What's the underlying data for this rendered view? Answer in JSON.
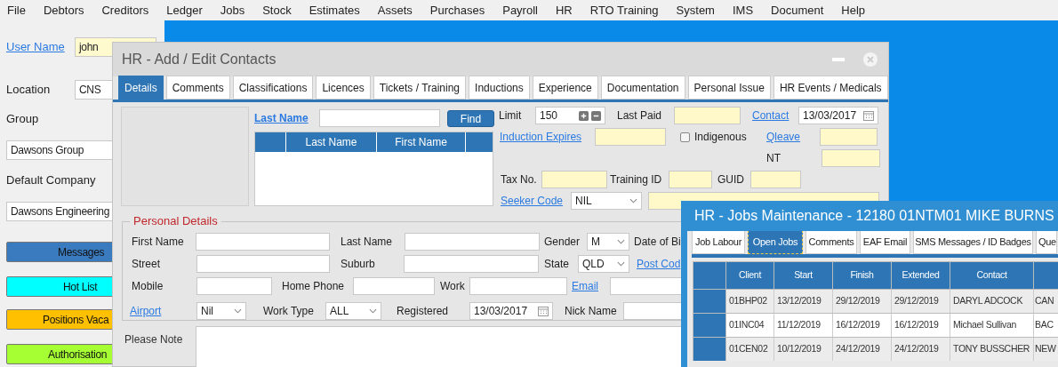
{
  "menu": [
    "File",
    "Debtors",
    "Creditors",
    "Ledger",
    "Jobs",
    "Stock",
    "Estimates",
    "Assets",
    "Purchases",
    "Payroll",
    "HR",
    "RTO Training",
    "System",
    "IMS",
    "Document",
    "Help"
  ],
  "sidebar": {
    "fields": [
      {
        "label": "User Name",
        "kind": "link",
        "value": "john",
        "highlighted": true
      },
      {
        "label": "Location",
        "kind": "label",
        "value": "CNS",
        "highlighted": false
      },
      {
        "label": "Group",
        "kind": "label",
        "value": "Dawsons Group",
        "highlighted": false
      },
      {
        "label": "Default Company",
        "kind": "label",
        "value": "Dawsons Engineering",
        "highlighted": false
      }
    ],
    "buttons": [
      {
        "label": "Messages",
        "color": "#3a7bbf"
      },
      {
        "label": "Hot List",
        "color": "#00ffff"
      },
      {
        "label": "Positions Vaca",
        "color": "#ffc000"
      },
      {
        "label": "Authorisation",
        "color": "#a6ff33"
      }
    ]
  },
  "contacts_window": {
    "title": "HR - Add / Edit Contacts",
    "tabs": [
      {
        "label": "Details",
        "selected": true
      },
      {
        "label": "Comments",
        "selected": false
      },
      {
        "label": "Classifications",
        "selected": false
      },
      {
        "label": "Licences",
        "selected": false
      },
      {
        "label": "Tickets / Training",
        "selected": false
      },
      {
        "label": "Inductions",
        "selected": false
      },
      {
        "label": "Experience",
        "selected": false
      },
      {
        "label": "Documentation",
        "selected": false
      },
      {
        "label": "Personal Issue",
        "selected": false
      },
      {
        "label": "HR Events / Medicals",
        "selected": false
      }
    ],
    "search": {
      "link": "Last Name",
      "button": "Find",
      "columns": [
        "Last Name",
        "First Name"
      ]
    },
    "fields": [
      [
        {
          "kind": "label",
          "text": "Limit"
        },
        {
          "kind": "spin",
          "value": "150"
        },
        {
          "kind": "label",
          "text": "Last Paid"
        },
        {
          "kind": "input",
          "highlighted": true
        },
        {
          "kind": "link",
          "text": "Contact"
        },
        {
          "kind": "date",
          "value": "13/03/2017"
        }
      ],
      [
        {
          "kind": "link",
          "text": "Induction Expires"
        },
        {
          "kind": "input",
          "highlighted": true
        },
        {
          "kind": "checkbox",
          "text": "Indigenous",
          "checked": false
        },
        {
          "kind": "link",
          "text": "Qleave"
        },
        {
          "kind": "input",
          "highlighted": true
        }
      ],
      [
        {
          "kind": "label",
          "text": "NT"
        },
        {
          "kind": "input",
          "highlighted": true
        }
      ],
      [
        {
          "kind": "label",
          "text": "Tax No."
        },
        {
          "kind": "input",
          "highlighted": true
        },
        {
          "kind": "label",
          "text": "Training ID"
        },
        {
          "kind": "input",
          "highlighted": true
        },
        {
          "kind": "label",
          "text": "GUID"
        },
        {
          "kind": "input",
          "highlighted": true
        }
      ],
      [
        {
          "kind": "link",
          "text": "Seeker Code"
        },
        {
          "kind": "select",
          "value": "NIL"
        },
        {
          "kind": "input",
          "highlighted": true
        }
      ]
    ],
    "personal_details": {
      "legend": "Personal Details",
      "rows": [
        [
          {
            "kind": "label",
            "text": "First Name"
          },
          {
            "kind": "input",
            "highlighted": false
          },
          {
            "kind": "label",
            "text": "Last Name"
          },
          {
            "kind": "input",
            "highlighted": false
          },
          {
            "kind": "label",
            "text": "Gender"
          },
          {
            "kind": "select",
            "value": "M"
          },
          {
            "kind": "label",
            "text": "Date of Bi"
          }
        ],
        [
          {
            "kind": "label",
            "text": "Street"
          },
          {
            "kind": "input",
            "highlighted": false
          },
          {
            "kind": "label",
            "text": "Suburb"
          },
          {
            "kind": "input",
            "highlighted": false
          },
          {
            "kind": "label",
            "text": "State"
          },
          {
            "kind": "select",
            "value": "QLD"
          },
          {
            "kind": "link",
            "text": "Post Cod"
          }
        ],
        [
          {
            "kind": "label",
            "text": "Mobile"
          },
          {
            "kind": "input",
            "highlighted": false
          },
          {
            "kind": "label",
            "text": "Home Phone"
          },
          {
            "kind": "input",
            "highlighted": false
          },
          {
            "kind": "label",
            "text": "Work"
          },
          {
            "kind": "input",
            "highlighted": false
          },
          {
            "kind": "link",
            "text": "Email"
          },
          {
            "kind": "input",
            "highlighted": false
          }
        ],
        [
          {
            "kind": "link",
            "text": "Airport"
          },
          {
            "kind": "select",
            "value": "Nil"
          },
          {
            "kind": "label",
            "text": "Work Type"
          },
          {
            "kind": "select",
            "value": "ALL"
          },
          {
            "kind": "label",
            "text": "Registered"
          },
          {
            "kind": "date",
            "value": "13/03/2017"
          },
          {
            "kind": "label",
            "text": "Nick Name"
          },
          {
            "kind": "input",
            "highlighted": false
          }
        ]
      ]
    },
    "note": {
      "label": "Please Note"
    }
  },
  "jobs_window": {
    "title": "HR - Jobs Maintenance - 12180 01NTM01 MIKE BURNS",
    "tabs": [
      {
        "label": "Job Labour",
        "selected": false
      },
      {
        "label": "Open Jobs",
        "selected": true
      },
      {
        "label": "Comments",
        "selected": false
      },
      {
        "label": "EAF Email",
        "selected": false
      },
      {
        "label": "SMS Messages / ID Badges",
        "selected": false
      },
      {
        "label": "Que",
        "selected": false
      }
    ],
    "table": {
      "columns": [
        "Client",
        "Start",
        "Finish",
        "Extended",
        "Contact"
      ],
      "rows": [
        [
          "01BHP02",
          "13/12/2019",
          "29/12/2019",
          "29/12/2019",
          "DARYL ADCOCK",
          "CAN"
        ],
        [
          "01INC04",
          "11/12/2019",
          "16/12/2019",
          "16/12/2019",
          "Michael Sullivan",
          "BAC"
        ],
        [
          "01CEN02",
          "10/12/2019",
          "24/12/2019",
          "24/12/2019",
          "TONY BUSSCHER",
          "NEW"
        ]
      ]
    }
  }
}
